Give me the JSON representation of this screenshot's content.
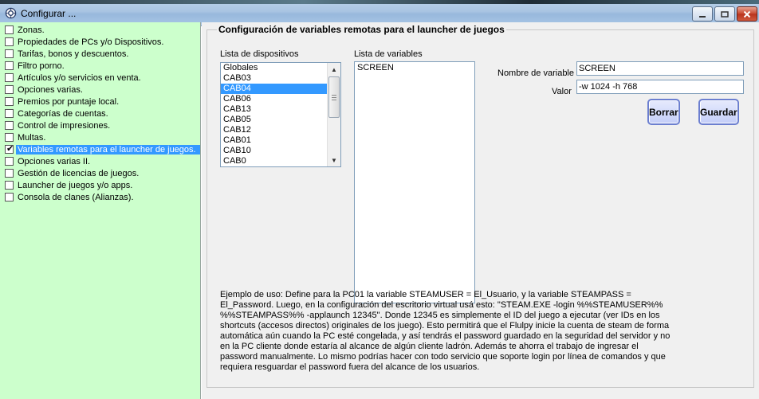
{
  "window": {
    "title": "Configurar ..."
  },
  "sidebar": {
    "items": [
      {
        "label": "Zonas.",
        "checked": false
      },
      {
        "label": "Propiedades de PCs y/o Dispositivos.",
        "checked": false
      },
      {
        "label": "Tarifas, bonos y descuentos.",
        "checked": false
      },
      {
        "label": "Filtro porno.",
        "checked": false
      },
      {
        "label": "Artículos y/o servicios en venta.",
        "checked": false
      },
      {
        "label": "Opciones varias.",
        "checked": false
      },
      {
        "label": "Premios por puntaje local.",
        "checked": false
      },
      {
        "label": "Categorías de cuentas.",
        "checked": false
      },
      {
        "label": "Control de impresiones.",
        "checked": false
      },
      {
        "label": "Multas.",
        "checked": false
      },
      {
        "label": "Variables remotas para el launcher de juegos.",
        "checked": true
      },
      {
        "label": "Opciones varias II.",
        "checked": false
      },
      {
        "label": "Gestión de licencias de juegos.",
        "checked": false
      },
      {
        "label": "Launcher de juegos y/o apps.",
        "checked": false
      },
      {
        "label": "Consola de clanes (Alianzas).",
        "checked": false
      }
    ]
  },
  "main": {
    "group_title": "Configuración de variables remotas para el launcher de juegos",
    "devices_label": "Lista de dispositivos",
    "devices": [
      "Globales",
      "CAB03",
      "CAB04",
      "CAB06",
      "CAB13",
      "CAB05",
      "CAB12",
      "CAB01",
      "CAB10",
      "CAB0"
    ],
    "selected_device": "CAB04",
    "variables_label": "Lista de variables",
    "variables": [
      "SCREEN"
    ],
    "name_label": "Nombre de variable",
    "name_value": "SCREEN",
    "value_label": "Valor",
    "value_value": "-w 1024 -h 768",
    "delete_button": "Borrar",
    "save_button": "Guardar",
    "help_text": "Ejemplo de uso: Define para la PC01 la variable STEAMUSER = El_Usuario, y la variable STEAMPASS =\nEl_Password. Luego, en la configuración del escritorio virtual usá esto: \"STEAM.EXE -login %%STEAMUSER%%\n%%STEAMPASS%% -applaunch 12345\". Donde 12345 es simplemente el ID del juego a ejecutar (ver IDs en los\nshortcuts (accesos directos) originales de los juego). Esto permitirá que el Flulpy inicie la cuenta de steam de forma\nautomática aún cuando la PC esté congelada, y así tendrás el password guardado en la seguridad del servidor y no\nen la PC cliente donde estaría al alcance de algún cliente ladrón. Además te ahorra el trabajo de ingresar el\npassword manualmente. Lo mismo podrías hacer con todo servicio que soporte login por línea de comandos y que\nrequiera resguardar el password fuera del alcance de los usuarios."
  }
}
